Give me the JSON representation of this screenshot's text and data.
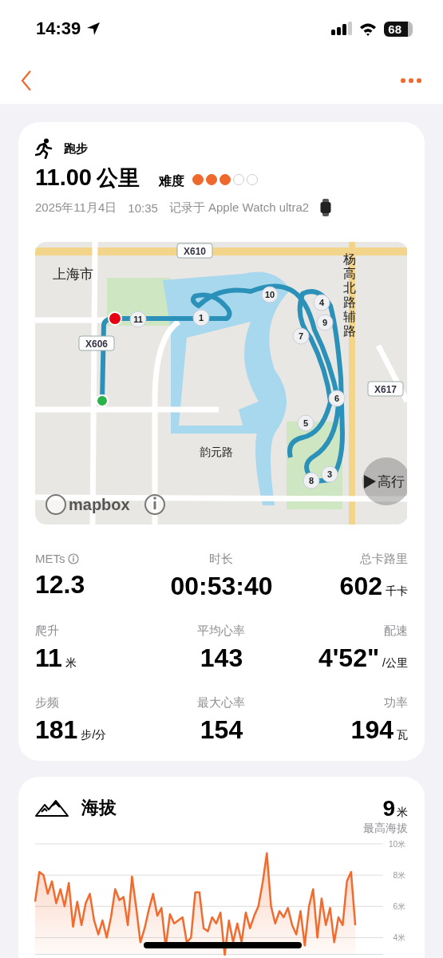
{
  "status_bar": {
    "time": "14:39",
    "battery": "68"
  },
  "workout": {
    "type": "跑步",
    "distance": "11.00",
    "distance_unit": "公里",
    "difficulty_label": "难度",
    "stars": 3,
    "date": "2025年11月4日",
    "time": "10:35",
    "source": "记录于 Apple Watch ultra2"
  },
  "map": {
    "labels": [
      {
        "text": "上海市",
        "kind": "place"
      },
      {
        "text": "X610",
        "kind": "sign"
      },
      {
        "text": "X606",
        "kind": "sign"
      },
      {
        "text": "X617",
        "kind": "sign"
      },
      {
        "text": "杨高北路辅路",
        "kind": "vertical"
      },
      {
        "text": "韵元路",
        "kind": "road"
      },
      {
        "text": "高行",
        "kind": "place"
      }
    ],
    "markers": [
      "11",
      "1",
      "10",
      "4",
      "9",
      "7",
      "6",
      "5",
      "3",
      "8"
    ],
    "attribution": "mapbox"
  },
  "stats": [
    {
      "label": "METs",
      "value": "12.3",
      "info": true
    },
    {
      "label": "时长",
      "value": "00:53:40"
    },
    {
      "label": "总卡路里",
      "value": "602",
      "unit": "千卡"
    },
    {
      "label": "爬升",
      "value": "11",
      "unit": "米"
    },
    {
      "label": "平均心率",
      "value": "143"
    },
    {
      "label": "配速",
      "value": "4'52\"",
      "unit": "/公里"
    },
    {
      "label": "步频",
      "value": "181",
      "unit": "步/分"
    },
    {
      "label": "最大心率",
      "value": "154"
    },
    {
      "label": "功率",
      "value": "194",
      "unit": "瓦"
    }
  ],
  "elevation": {
    "title": "海拔",
    "max_value": "9",
    "max_unit": "米",
    "max_label": "最高海拔",
    "chart_data": {
      "type": "area",
      "grid": true,
      "ylim": [
        2.9,
        10
      ],
      "categories": [
        null,
        null,
        null,
        null,
        null,
        null,
        null,
        null,
        null,
        null,
        null,
        null,
        null,
        null,
        null,
        null,
        null,
        null,
        null,
        null,
        null,
        null,
        null,
        null,
        null,
        null,
        null,
        null,
        null,
        null,
        null,
        null,
        null,
        null,
        null,
        null,
        null,
        null,
        null,
        null,
        null,
        null,
        null,
        null,
        null,
        null,
        null,
        null,
        null,
        null,
        null,
        null,
        null,
        null,
        null,
        null,
        null,
        null,
        null,
        null,
        null,
        null,
        null,
        null,
        null,
        null,
        null,
        null,
        null,
        null,
        null,
        null,
        null,
        null,
        null,
        null,
        null
      ],
      "yticks": [
        {
          "value": 10,
          "label": "10米"
        },
        {
          "value": 8,
          "label": "8米"
        },
        {
          "value": 6,
          "label": "6米"
        },
        {
          "value": 4,
          "label": "4米"
        }
      ],
      "series": [
        {
          "color": "#f26b2e",
          "values": [
            6.3,
            8.2,
            8.0,
            6.8,
            7.6,
            6.2,
            7.1,
            6.0,
            7.5,
            4.7,
            6.3,
            4.8,
            6.2,
            6.8,
            5.1,
            4.2,
            5.1,
            4.0,
            5.3,
            7.1,
            6.4,
            6.6,
            4.8,
            7.9,
            5.9,
            3.7,
            4.6,
            5.8,
            6.8,
            5.4,
            5.9,
            3.4,
            5.5,
            4.9,
            null,
            5.3,
            3.7,
            4.0,
            6.9,
            6.9,
            4.6,
            4.4,
            5.3,
            4.9,
            5.6,
            2.9,
            5.1,
            3.7,
            4.9,
            3.7,
            5.6,
            4.6,
            5.4,
            6.0,
            7.5,
            9.4,
            6.0,
            4.9,
            5.7,
            5.3,
            5.9,
            4.8,
            4.2,
            5.7,
            3.5,
            6.0,
            7.1,
            4.0,
            6.5,
            4.8,
            5.9,
            3.7,
            5.3,
            4.8,
            7.6,
            8.2,
            4.8
          ]
        }
      ]
    }
  }
}
